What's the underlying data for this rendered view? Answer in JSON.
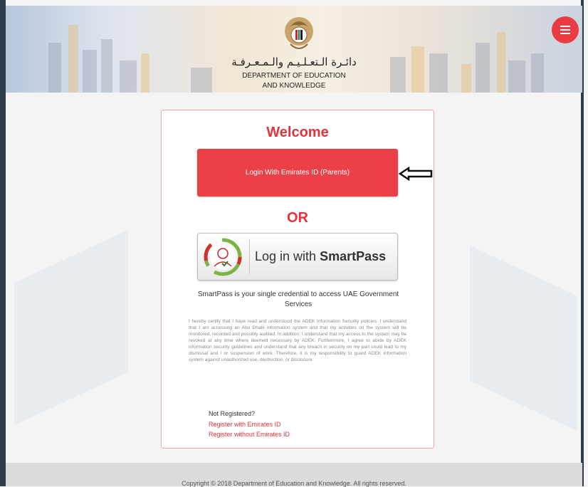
{
  "header": {
    "org_name_ar": "دائـرة الـتعـلـيـم والـمـعـرفـة",
    "org_name_en_line1": "DEPARTMENT OF EDUCATION",
    "org_name_en_line2": "AND KNOWLEDGE",
    "menu_icon": "hamburger-menu-icon"
  },
  "login": {
    "welcome": "Welcome",
    "emirates_button": "Login With Emirates ID (Parents)",
    "or_text": "OR",
    "smartpass_prefix": "Log in with ",
    "smartpass_brand": "SmartPass",
    "smartpass_description": "SmartPass is your single credential to access UAE Government Services",
    "disclaimer": "I hereby certify that I have read and understood the ADEK Information Security policies. I understand that I am accessing an Abu Dhabi information system and that my activities on the system will be monitored, recorded and possibly audited. In addition, I understand that my access to the system may be revoked at any time where deemed necessary by ADEK. Furthermore, I agree to abide by ADEK information security guidelines and understand that any breach in security on my part could lead to my dismissal and / or suspension of work. Therefore, it is my responsibility to guard ADEK information system against unauthorized use, destruction, or disclosure.",
    "not_registered": "Not Registered?",
    "register_with_eid": "Register with Emirates ID",
    "register_without_eid": "Register without Emirates ID"
  },
  "footer": {
    "copyright": "Copyright © 2018 Department of Education and Knowledge. All rights reserved."
  },
  "colors": {
    "accent": "#ec4048",
    "accent_text": "#e2343d"
  }
}
